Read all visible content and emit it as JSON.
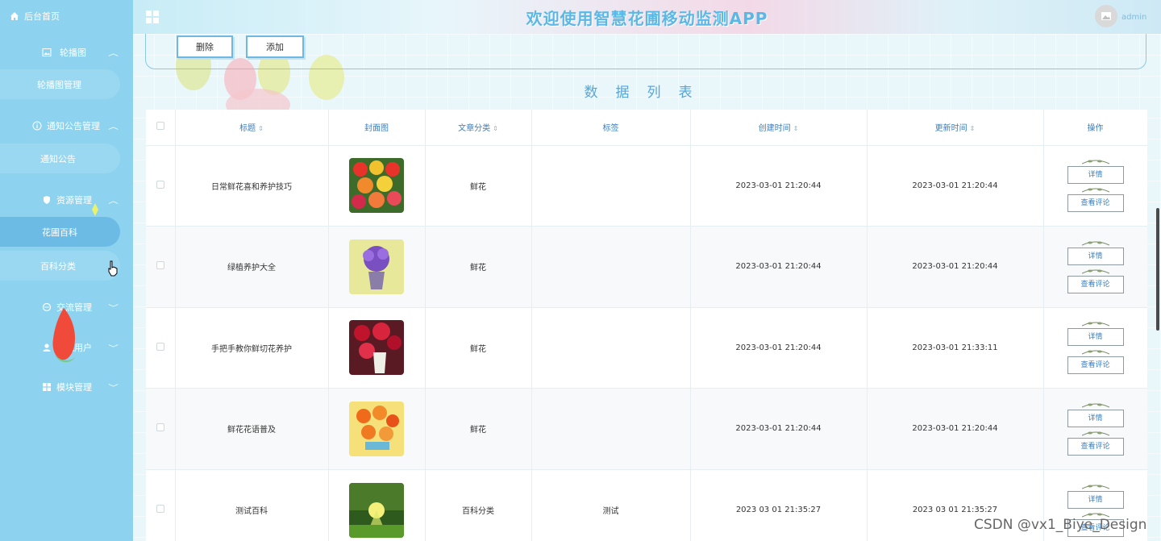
{
  "sidebar": {
    "home": "后台首页",
    "groups": [
      {
        "label": "轮播图",
        "icon": "image-icon",
        "sub": "轮播图管理"
      },
      {
        "label": "通知公告管理",
        "icon": "info-circle-icon",
        "sub": "通知公告"
      },
      {
        "label": "资源管理",
        "icon": "shield-icon",
        "subs": [
          "花圃百科",
          "百科分类"
        ]
      },
      {
        "label": "交流管理",
        "icon": "chat-icon"
      },
      {
        "label": "系统用户",
        "icon": "user-icon"
      },
      {
        "label": "模块管理",
        "icon": "grid-icon"
      }
    ]
  },
  "header": {
    "title": "欢迎使用智慧花圃移动监测APP",
    "username": "admin"
  },
  "toolbar": {
    "delete_label": "删除",
    "add_label": "添加"
  },
  "list_title": "数据列表",
  "table": {
    "columns": [
      "标题",
      "封面图",
      "文章分类",
      "标签",
      "创建时间",
      "更新时间",
      "操作"
    ],
    "rows": [
      {
        "title": "日常鲜花喜和养护技巧",
        "category": "鲜花",
        "tag": "",
        "created": "2023-03-01 21:20:44",
        "updated": "2023-03-01 21:20:44",
        "actions": [
          "详情",
          "查看评论"
        ],
        "thumb": "tulips"
      },
      {
        "title": "绿植养护大全",
        "category": "鲜花",
        "tag": "",
        "created": "2023-03-01 21:20:44",
        "updated": "2023-03-01 21:20:44",
        "actions": [
          "详情",
          "查看评论"
        ],
        "thumb": "purple-pot"
      },
      {
        "title": "手把手教你鲜切花养护",
        "category": "鲜花",
        "tag": "",
        "created": "2023-03-01 21:20:44",
        "updated": "2023-03-01 21:33:11",
        "actions": [
          "详情",
          "查看评论"
        ],
        "thumb": "red-bouquet"
      },
      {
        "title": "鲜花花语普及",
        "category": "鲜花",
        "tag": "",
        "created": "2023-03-01 21:20:44",
        "updated": "2023-03-01 21:20:44",
        "actions": [
          "详情",
          "查看评论"
        ],
        "thumb": "orange-tulips"
      },
      {
        "title": "测试百科",
        "category": "百科分类",
        "tag": "测试",
        "created": "2023 03 01 21:35:27",
        "updated": "2023 03 01 21:35:27",
        "actions": [
          "详情",
          "查看评论"
        ],
        "thumb": "forest-sun"
      }
    ]
  },
  "watermark": "CSDN @vx1_Biye_Design",
  "colors": {
    "sidebar": "#8dd3ef",
    "active_item": "#6cbbe5",
    "title": "#5bb8e6",
    "header_link": "#3a7dbf"
  }
}
